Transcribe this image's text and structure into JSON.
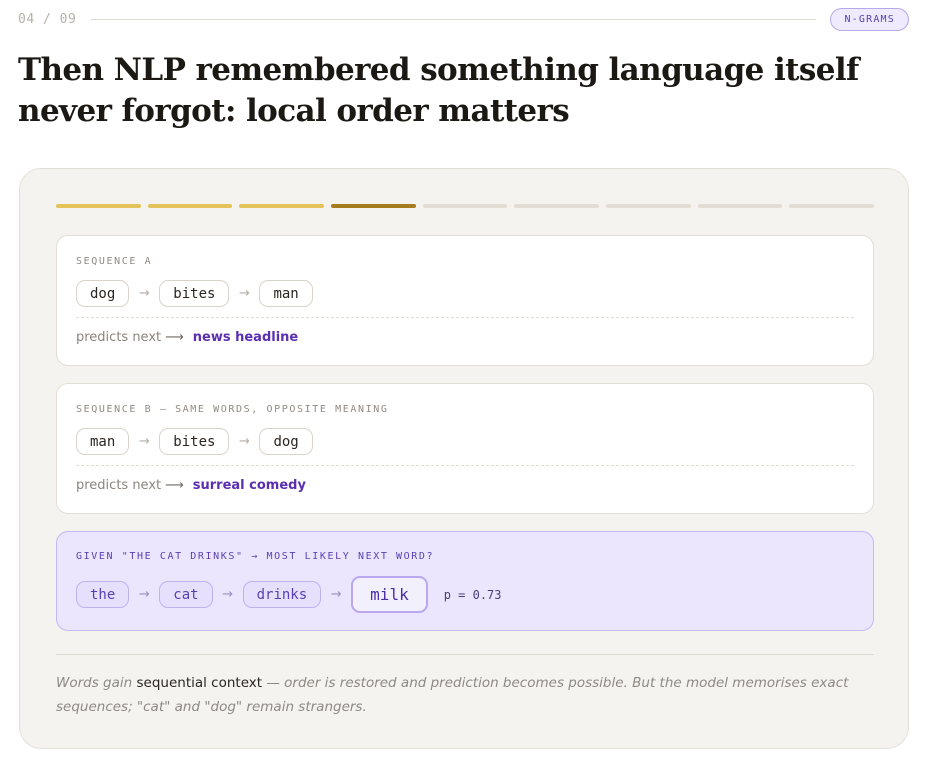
{
  "header": {
    "pager": "04 / 09",
    "tag": "N-GRAMS"
  },
  "title": "Then NLP remembered something language itself never forgot: local order matters",
  "progress": {
    "total_steps": 9,
    "current_step": 4
  },
  "sequence_a": {
    "label": "SEQUENCE A",
    "tokens": [
      "dog",
      "bites",
      "man"
    ],
    "predicts_label": "predicts next",
    "outcome": "news headline"
  },
  "sequence_b": {
    "label": "SEQUENCE B — SAME WORDS, OPPOSITE MEANING",
    "tokens": [
      "man",
      "bites",
      "dog"
    ],
    "predicts_label": "predicts next",
    "outcome": "surreal comedy"
  },
  "prediction": {
    "label": "GIVEN \"THE CAT DRINKS\" → MOST LIKELY NEXT WORD?",
    "tokens": [
      "the",
      "cat",
      "drinks"
    ],
    "predicted": "milk",
    "probability": "p = 0.73"
  },
  "caption": {
    "lead": "Words gain ",
    "emphasis": "sequential context",
    "rest": " — order is restored and prediction becomes possible. But the model memorises exact sequences; \"cat\" and \"dog\" remain strangers."
  },
  "icons": {
    "arrow": "right-arrow-icon"
  },
  "colors": {
    "progress_done": "#e3c25a",
    "progress_current": "#a67c1f",
    "progress_todo": "#e2ddd3",
    "accent_purple": "#5a2fb0",
    "prediction_card_bg": "#ebe6fd"
  }
}
